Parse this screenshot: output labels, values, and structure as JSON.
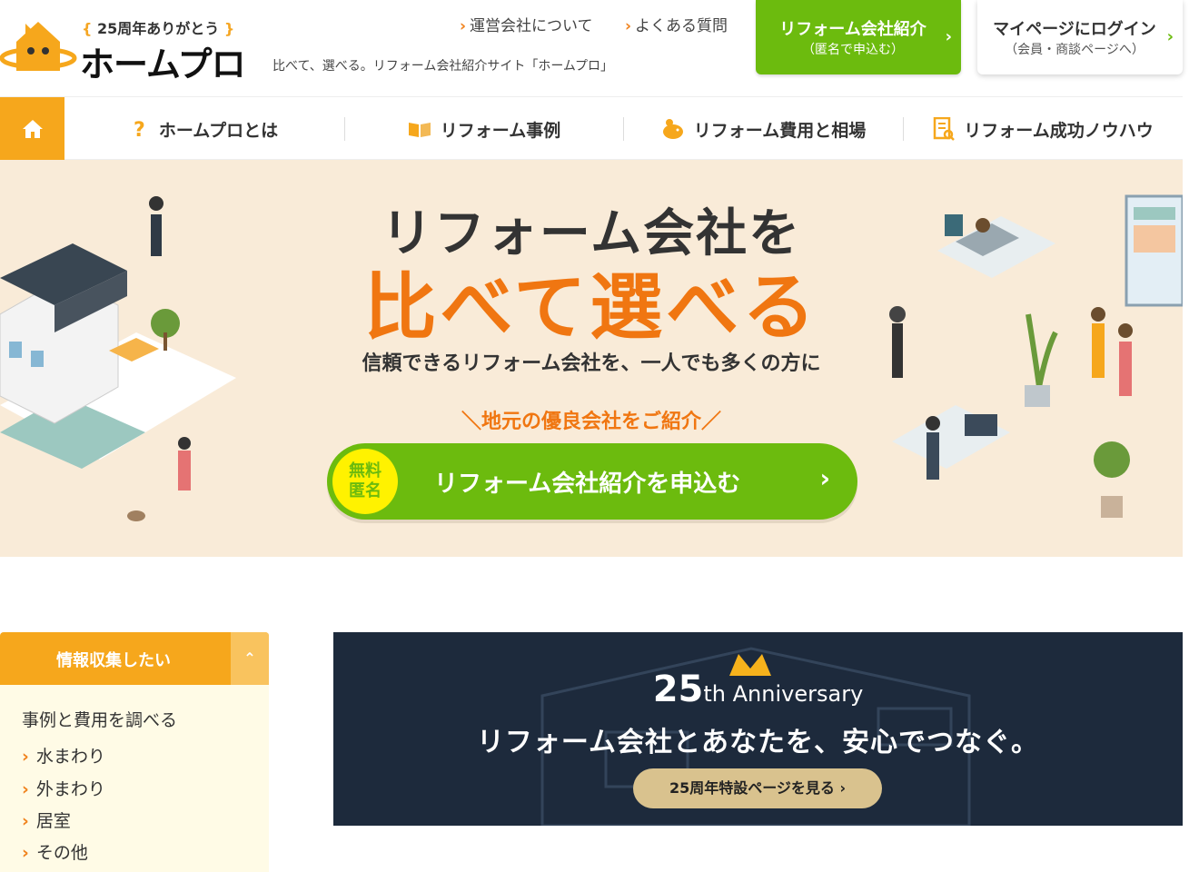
{
  "header": {
    "anniversary": "25周年ありがとう",
    "brand": "ホームプロ",
    "tagline": "比べて、選べる。リフォーム会社紹介サイト「ホームプロ」",
    "links": [
      {
        "label": "運営会社について"
      },
      {
        "label": "よくある質問"
      }
    ],
    "reform_button": {
      "title": "リフォーム会社紹介",
      "sub": "（匿名で申込む）"
    },
    "login_button": {
      "title": "マイページにログイン",
      "sub": "（会員・商談ページへ）"
    }
  },
  "nav": {
    "items": [
      {
        "label": "ホームプロとは",
        "icon": "question-icon"
      },
      {
        "label": "リフォーム事例",
        "icon": "book-icon"
      },
      {
        "label": "リフォーム費用と相場",
        "icon": "piggy-bank-icon"
      },
      {
        "label": "リフォーム成功ノウハウ",
        "icon": "document-icon"
      }
    ]
  },
  "hero": {
    "headline": "リフォーム会社を",
    "headline_accent": "比べて選べる",
    "subline": "信頼できるリフォーム会社を、一人でも多くの方に",
    "local": "＼地元の優良会社をご紹介／",
    "cta": {
      "badge_line1": "無料",
      "badge_line2": "匿名",
      "label": "リフォーム会社紹介を申込む"
    }
  },
  "sidebar": {
    "header": "情報収集したい",
    "section_title": "事例と費用を調べる",
    "links": [
      {
        "label": "水まわり"
      },
      {
        "label": "外まわり"
      },
      {
        "label": "居室"
      },
      {
        "label": "その他"
      }
    ]
  },
  "banner": {
    "anniversary_number": "25",
    "anniversary_suffix": "th Anniversary",
    "headline": "リフォーム会社とあなたを、安心でつなぐ。",
    "button": "25周年特設ページを見る ›"
  },
  "colors": {
    "orange": "#f6a71c",
    "accent_orange": "#f07611",
    "green": "#6cbb0e",
    "hero_bg": "#f9ebd8",
    "banner_bg": "#1d2a3c"
  }
}
